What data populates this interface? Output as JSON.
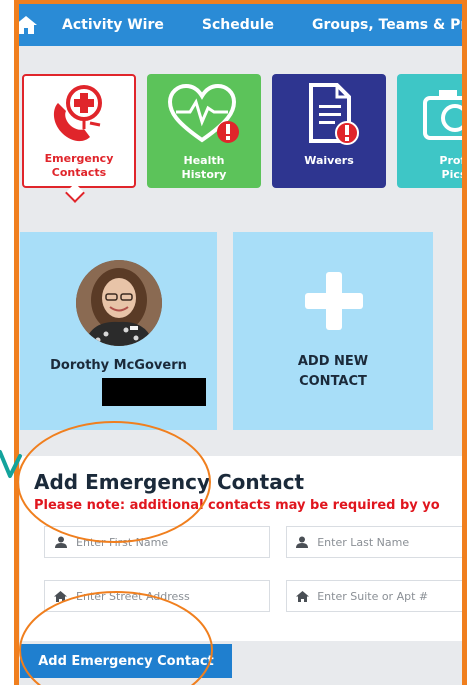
{
  "nav": {
    "items": [
      "Activity Wire",
      "Schedule",
      "Groups, Teams & Pr"
    ]
  },
  "tiles": [
    {
      "label_line1": "Emergency",
      "label_line2": "Contacts",
      "icon": "phone-medical-icon"
    },
    {
      "label_line1": "Health",
      "label_line2": "History",
      "icon": "heart-monitor-icon"
    },
    {
      "label_line1": "Waivers",
      "label_line2": "",
      "icon": "document-alert-icon"
    },
    {
      "label_line1": "Profi",
      "label_line2": "Pics",
      "icon": "camera-icon"
    }
  ],
  "contact": {
    "name": "Dorothy McGovern"
  },
  "add_contact": {
    "line1": "ADD NEW",
    "line2": "CONTACT"
  },
  "form": {
    "title": "Add Emergency Contact",
    "note": "Please note: additional contacts may be required by yo",
    "first_name_placeholder": "Enter First Name",
    "last_name_placeholder": "Enter Last Name",
    "street_placeholder": "Enter Street Address",
    "suite_placeholder": "Enter Suite or Apt #"
  },
  "submit_label": "Add Emergency Contact",
  "colors": {
    "nav_blue": "#2a8bd6",
    "emergency_red": "#e0252b",
    "health_green": "#5cc35a",
    "waivers_navy": "#2e3590",
    "profile_teal": "#3ec6c6",
    "card_blue": "#a8def8",
    "annotation_orange": "#f07f1e",
    "arrow_teal": "#13a39c"
  }
}
